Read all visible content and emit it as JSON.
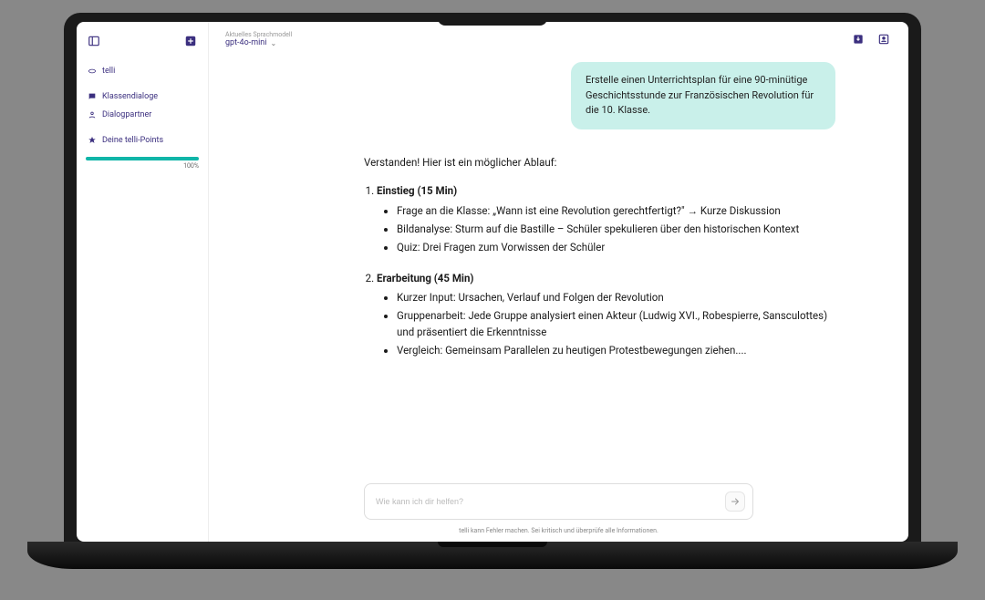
{
  "header": {
    "model_label": "Aktuelles Sprachmodell",
    "model_value": "gpt-4o-mini"
  },
  "sidebar": {
    "brand": "telli",
    "items": [
      {
        "label": "Klassendialoge"
      },
      {
        "label": "Dialogpartner"
      }
    ],
    "points_label": "Deine telli-Points",
    "points_pct": "100%"
  },
  "chat": {
    "user_message": "Erstelle einen Unterrichtsplan für eine 90-minütige Geschichtsstunde zur Französischen Revolution für die 10. Klasse.",
    "assistant_intro": "Verstanden! Hier ist ein möglicher Ablauf:",
    "sections": [
      {
        "title": "Einstieg (15 Min)",
        "bullets": [
          "Frage an die Klasse: „Wann ist eine Revolution gerechtfertigt?\" → Kurze Diskussion",
          "Bildanalyse: Sturm auf die Bastille – Schüler spekulieren über den historischen Kontext",
          "Quiz: Drei Fragen zum Vorwissen der Schüler"
        ]
      },
      {
        "title": "Erarbeitung (45 Min)",
        "bullets": [
          "Kurzer Input: Ursachen, Verlauf und Folgen der Revolution",
          "Gruppenarbeit: Jede Gruppe analysiert einen Akteur (Ludwig XVI., Robespierre, Sansculottes) und präsentiert die Erkenntnisse",
          "Vergleich: Gemeinsam Parallelen zu heutigen Protestbewegungen ziehen...."
        ]
      }
    ]
  },
  "input": {
    "placeholder": "Wie kann ich dir helfen?"
  },
  "footer": {
    "note": "telli kann Fehler machen. Sei kritisch und überprüfe alle Informationen."
  }
}
